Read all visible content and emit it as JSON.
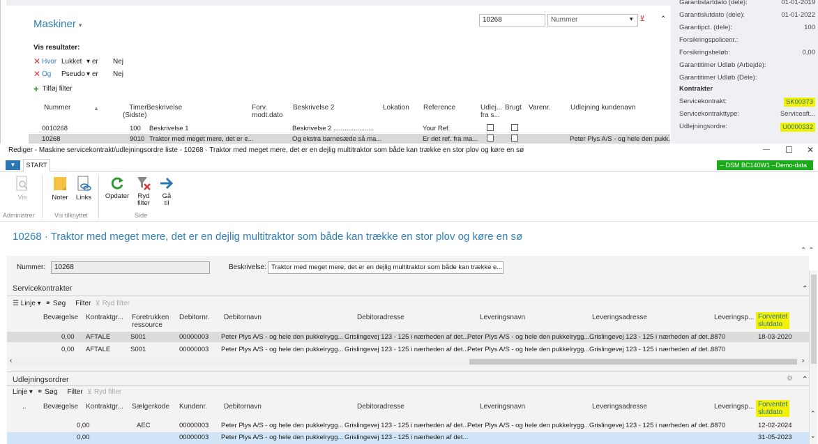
{
  "bg": {
    "list_title": "Maskiner",
    "vis_resultater": "Vis resultater:",
    "filters": [
      {
        "op": "Hvor",
        "field": "Lukket",
        "cmp": "er",
        "val": "Nej"
      },
      {
        "op": "Og",
        "field": "Pseudo",
        "cmp": "er",
        "val": "Nej"
      }
    ],
    "add_filter": "Tilføj filter",
    "search_value": "10268",
    "search_field": "Nummer",
    "columns": {
      "nummer": "Nummer",
      "timer": "Timer",
      "timer2": "(Sidste)",
      "beskrivelse": "Beskrivelse",
      "forv": "Forv.",
      "forv2": "modt.dato",
      "beskrivelse2": "Beskrivelse 2",
      "lokation": "Lokation",
      "reference": "Reference",
      "udl": "Udlej...",
      "udl2": "fra s...",
      "brugt": "Brugt",
      "varenr": "Varenr.",
      "udlejning": "Udlejning kundenavn"
    },
    "rows": [
      {
        "nummer": "0010268",
        "timer": "100",
        "beskrivelse": "Beskrivelse 1",
        "beskrivelse2": "Beskrivelse 2 ......................",
        "reference": "Your Ref.",
        "udlejning": ""
      },
      {
        "nummer": "10268",
        "timer": "9010",
        "beskrivelse": "Traktor med meget mere, det er e...",
        "beskrivelse2": "Og ekstra barnesæde så ma...",
        "reference": "Er det ref. fra ma...",
        "udlejning": "Peter Plys A/S - og hele den pukk..."
      }
    ],
    "factbox": [
      {
        "k": "Garantistartdato (dele):",
        "v": "01-01-2019"
      },
      {
        "k": "Garantislutdato (dele):",
        "v": "01-01-2022"
      },
      {
        "k": "Garantipct. (dele):",
        "v": "100"
      },
      {
        "k": "Forsikringspolicenr.:",
        "v": ""
      },
      {
        "k": "Forsikringsbeløb:",
        "v": "0,00"
      },
      {
        "k": "Garantitimer Udløb (Arbejde):",
        "v": ""
      },
      {
        "k": "Garantitimer Udløb (Dele):",
        "v": ""
      }
    ],
    "kontrakter_header": "Kontrakter",
    "kontrakter": [
      {
        "k": "Servicekontrakt:",
        "v": "SK00373"
      },
      {
        "k": "Servicekontrakttype:",
        "v": "Serviceaft..."
      },
      {
        "k": "Udlejningsordre:",
        "v": "U0000332"
      }
    ]
  },
  "window": {
    "title": "Rediger - Maskine servicekontrakt/udlejningsordre liste - 10268 · Traktor med meget mere, det er en dejlig multitraktor som både kan trække en stor plov og køre en sø",
    "minimize": "—",
    "maximize": "☐",
    "close": "✕"
  },
  "ribbon": {
    "file_menu": "▼",
    "tab_start": "START",
    "env": "-- DSM BC140W1 --Demo-data",
    "buttons": {
      "vis": "Vis",
      "noter": "Noter",
      "links": "Links",
      "opdater": "Opdater",
      "ryd1": "Ryd",
      "ryd2": "filter",
      "ga1": "Gå",
      "ga2": "til"
    },
    "groups": {
      "administrer": "Administrer",
      "vis_tilknyttet": "Vis tilknyttet",
      "side": "Side"
    }
  },
  "page": {
    "title": "10268 · Traktor med meget mere, det er en dejlig multitraktor som både kan trække en stor plov og køre en sø",
    "nummer_label": "Nummer:",
    "nummer_value": "10268",
    "beskrivelse_label": "Beskrivelse:",
    "beskrivelse_value": "Traktor med meget mere, det er en dejlig multitraktor som både kan trække e..."
  },
  "service": {
    "title": "Servicekontrakter",
    "toolbar": {
      "linje": "Linje",
      "sog": "Søg",
      "filter": "Filter",
      "ryd": "Ryd filter"
    },
    "cols": {
      "bevaegelse": "Bevægelse",
      "kontrakt": "Kontraktgr...",
      "foretrukken1": "Foretrukken",
      "foretrukken2": "ressource",
      "debitornr": "Debitornr.",
      "debitornavn": "Debitornavn",
      "debitoradresse": "Debitoradresse",
      "leveringsnavn": "Leveringsnavn",
      "leveringsadresse": "Leveringsadresse",
      "leveringsp": "Leveringsp...",
      "forventet1": "Forventet",
      "forventet2": "slutdato"
    },
    "rows": [
      {
        "bev": "0,00",
        "kon": "AFTALE",
        "for": "S001",
        "debnr": "00000003",
        "debnavn": "Peter Plys A/S - og hele den pukkelrygg...",
        "debadr": "Grislingevej 123 - 125 i nærheden af det...",
        "levnavn": "Peter Plys A/S - og hele den pukkelrygg...",
        "levadr": "Grislingevej 123 - 125 i nærheden af det...",
        "levp": "8870",
        "slut": "18-03-2020"
      },
      {
        "bev": "0,00",
        "kon": "AFTALE",
        "for": "S001",
        "debnr": "00000003",
        "debnavn": "Peter Plys A/S - og hele den pukkelrygg...",
        "debadr": "Grislingevej 123 - 125 i nærheden af det...",
        "levnavn": "Peter Plys A/S - og hele den pukkelrygg...",
        "levadr": "Grislingevej 123 - 125 i nærheden af det...",
        "levp": "8870",
        "slut": ""
      }
    ]
  },
  "udlejning": {
    "title": "Udlejningsordrer",
    "toolbar": {
      "linje": "Linje",
      "sog": "Søg",
      "filter": "Filter",
      "ryd": "Ryd filter"
    },
    "cols": {
      "dots": "..",
      "bevaegelse": "Bevægelse",
      "kontrakt": "Kontraktgr...",
      "saelger": "Sælgerkode",
      "kundenr": "Kundenr.",
      "debitornavn": "Debitornavn",
      "debitoradresse": "Debitoradresse",
      "leveringsnavn": "Leveringsnavn",
      "leveringsadresse": "Leveringsadresse",
      "leveringsp": "Leveringsp...",
      "forventet1": "Forventet",
      "forventet2": "slutdato"
    },
    "rows": [
      {
        "bev": "0,00",
        "sae": "AEC",
        "knr": "00000003",
        "debnavn": "Peter Plys A/S - og hele den pukkelrygg...",
        "debadr": "Grislingevej 123 - 125 i nærheden af det...",
        "levnavn": "Peter Plys A/S - og hele den pukkelrygg...",
        "levadr": "Grislingevej 123 - 125 i nærheden af det...",
        "levp": "8870",
        "slut": "12-02-2024"
      },
      {
        "bev": "0,00",
        "sae": "",
        "knr": "00000003",
        "debnavn": "Peter Plys A/S - og hele den pukkelrygg...",
        "debadr": "Grislingevej 123 - 125 i nærheden af det...",
        "levnavn": "",
        "levadr": "",
        "levp": "",
        "slut": "31-05-2023"
      }
    ]
  }
}
